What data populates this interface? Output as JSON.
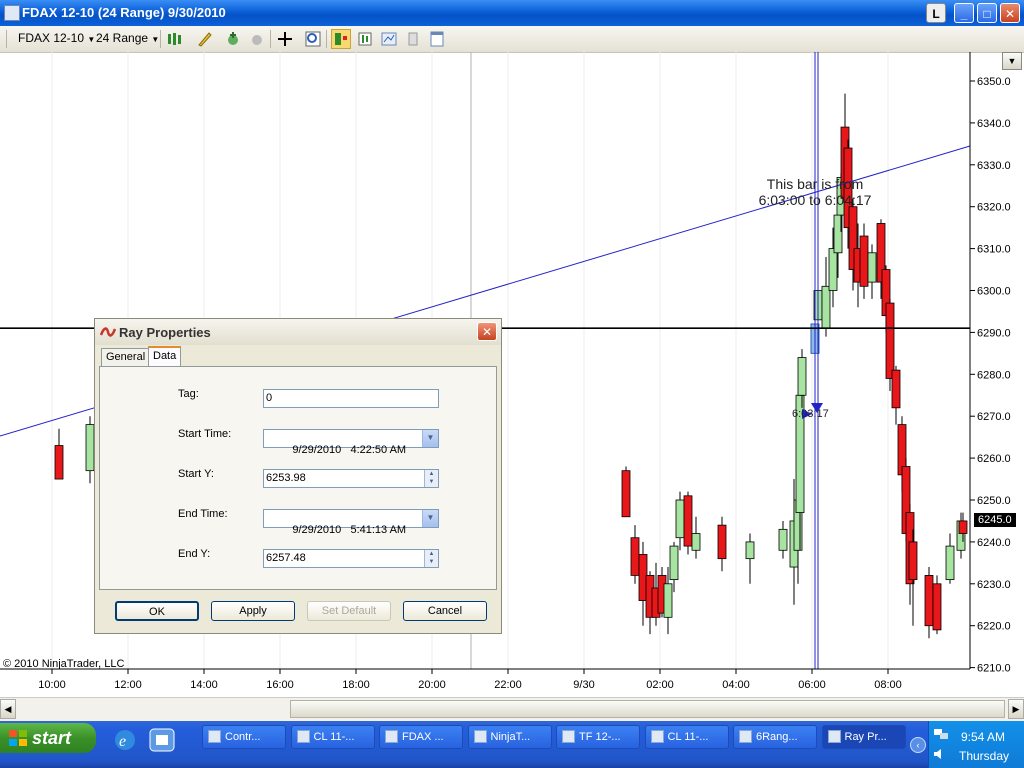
{
  "window": {
    "title": "FDAX 12-10 (24 Range)  9/30/2010",
    "l_label": "L"
  },
  "toolbar": {
    "instrument": "FDAX 12-10",
    "interval": "24 Range"
  },
  "chart": {
    "copyright": "© 2010 NinjaTrader, LLC",
    "y_labels": [
      "6350.0",
      "6340.0",
      "6330.0",
      "6320.0",
      "6310.0",
      "6300.0",
      "6290.0",
      "6280.0",
      "6270.0",
      "6260.0",
      "6250.0",
      "6240.0",
      "6230.0",
      "6220.0",
      "6210.0"
    ],
    "x_labels": [
      "10:00",
      "12:00",
      "14:00",
      "16:00",
      "18:00",
      "20:00",
      "22:00",
      "9/30",
      "02:00",
      "04:00",
      "06:00",
      "08:00"
    ],
    "price_marker": "6245.0",
    "bar_info_line1": "This bar is from",
    "bar_info_line2": "6:03:00 to 6:04:17",
    "marker_label": "6:03:17",
    "colors": {
      "up": "#a7e3a1",
      "down": "#e8181a",
      "ray": "#2323c8",
      "hline": "#000000"
    }
  },
  "chart_data": {
    "type": "candlestick",
    "y_range": [
      6210,
      6350
    ],
    "horizontal_line": 6291,
    "ray": {
      "start_price": 6253.98,
      "end_price": 6257.48
    }
  },
  "dialog": {
    "title": "Ray Properties",
    "tabs": [
      "General",
      "Data"
    ],
    "fields": {
      "tag_label": "Tag:",
      "tag_value": "0",
      "start_time_label": "Start Time:",
      "start_time_value": "9/29/2010   4:22:50 AM",
      "start_y_label": "Start Y:",
      "start_y_value": "6253.98",
      "end_time_label": "End Time:",
      "end_time_value": "9/29/2010   5:41:13 AM",
      "end_y_label": "End Y:",
      "end_y_value": "6257.48"
    },
    "buttons": {
      "ok": "OK",
      "apply": "Apply",
      "set_default": "Set Default",
      "cancel": "Cancel"
    }
  },
  "taskbar": {
    "start_label": "start",
    "items": [
      "Contr...",
      "CL 11-...",
      "FDAX ...",
      "NinjaT...",
      "TF 12-...",
      "CL 11-...",
      "6Rang...",
      "Ray Pr..."
    ],
    "clock": "9:54 AM",
    "day": "Thursday"
  }
}
